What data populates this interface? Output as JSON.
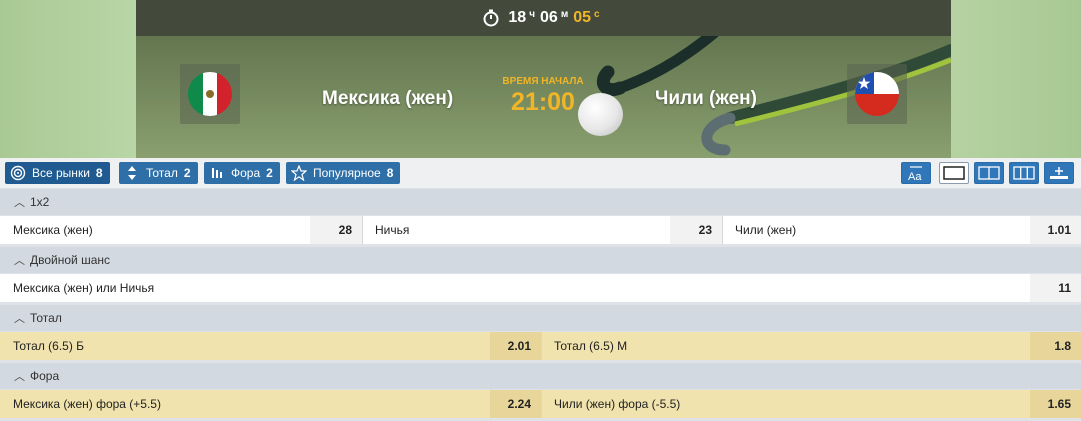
{
  "timer": {
    "hours": "18",
    "hours_unit": "ч",
    "minutes": "06",
    "minutes_unit": "м",
    "seconds": "05",
    "seconds_unit": "с"
  },
  "match": {
    "team_home": "Мексика (жен)",
    "team_away": "Чили (жен)",
    "start_label": "ВРЕМЯ НАЧАЛА",
    "start_time": "21:00"
  },
  "tabs": [
    {
      "label": "Все рынки",
      "count": "8",
      "icon": "target-icon"
    },
    {
      "label": "Тотал",
      "count": "2",
      "icon": "updown-arrows-icon"
    },
    {
      "label": "Фора",
      "count": "2",
      "icon": "bars-icon"
    },
    {
      "label": "Популярное",
      "count": "8",
      "icon": "star-icon"
    }
  ],
  "markets": {
    "m1x2": {
      "title": "1х2",
      "outcomes": [
        {
          "name": "Мексика (жен)",
          "odd": "28"
        },
        {
          "name": "Ничья",
          "odd": "23"
        },
        {
          "name": "Чили (жен)",
          "odd": "1.01"
        }
      ]
    },
    "double": {
      "title": "Двойной шанс",
      "outcomes": [
        {
          "name": "Мексика (жен) или Ничья",
          "odd": "11"
        }
      ]
    },
    "total": {
      "title": "Тотал",
      "outcomes": [
        {
          "name": "Тотал (6.5) Б",
          "odd": "2.01"
        },
        {
          "name": "Тотал (6.5) М",
          "odd": "1.8"
        }
      ]
    },
    "handicap": {
      "title": "Фора",
      "outcomes": [
        {
          "name": "Мексика (жен) фора (+5.5)",
          "odd": "2.24"
        },
        {
          "name": "Чили (жен) фора (-5.5)",
          "odd": "1.65"
        }
      ]
    }
  },
  "colors": {
    "accent": "#2f6fa8",
    "highlight": "#f2b527",
    "row_yellow": "#f0e3ad"
  }
}
